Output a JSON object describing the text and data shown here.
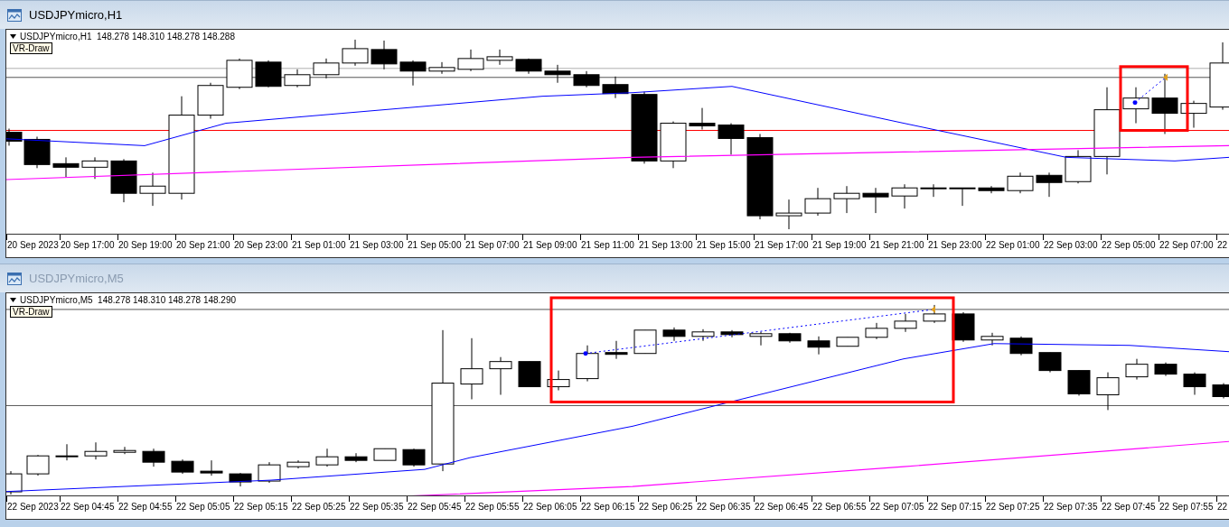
{
  "windows": [
    {
      "title": "USDJPYmicro,H1",
      "active": true,
      "header": "USDJPYmicro,H1  148.278 148.310 148.278 148.288",
      "indicator": "VR-Draw",
      "x_labels": [
        "20 Sep 2023",
        "20 Sep 17:00",
        "20 Sep 19:00",
        "20 Sep 21:00",
        "20 Sep 23:00",
        "21 Sep 01:00",
        "21 Sep 03:00",
        "21 Sep 05:00",
        "21 Sep 07:00",
        "21 Sep 09:00",
        "21 Sep 11:00",
        "21 Sep 13:00",
        "21 Sep 15:00",
        "21 Sep 17:00",
        "21 Sep 19:00",
        "21 Sep 21:00",
        "21 Sep 23:00",
        "22 Sep 01:00",
        "22 Sep 03:00",
        "22 Sep 05:00",
        "22 Sep 07:00",
        "22"
      ]
    },
    {
      "title": "USDJPYmicro,M5",
      "active": false,
      "header": "USDJPYmicro,M5  148.278 148.310 148.278 148.290",
      "indicator": "VR-Draw",
      "x_labels": [
        "22 Sep 2023",
        "22 Sep 04:45",
        "22 Sep 04:55",
        "22 Sep 05:05",
        "22 Sep 05:15",
        "22 Sep 05:25",
        "22 Sep 05:35",
        "22 Sep 05:45",
        "22 Sep 05:55",
        "22 Sep 06:05",
        "22 Sep 06:15",
        "22 Sep 06:25",
        "22 Sep 06:35",
        "22 Sep 06:45",
        "22 Sep 06:55",
        "22 Sep 07:05",
        "22 Sep 07:15",
        "22 Sep 07:25",
        "22 Sep 07:35",
        "22 Sep 07:45",
        "22 Sep 07:55",
        "22"
      ]
    }
  ]
}
